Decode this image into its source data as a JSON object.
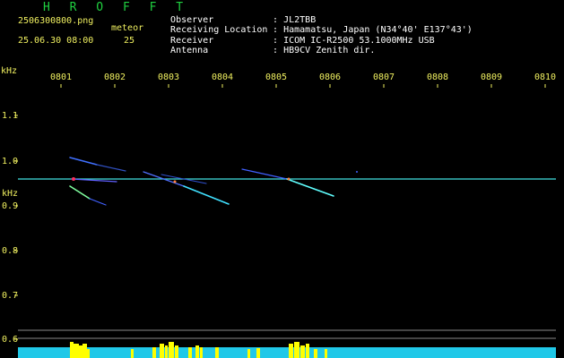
{
  "header": {
    "title": "H R O F F T",
    "filename": "2506300800.png",
    "datetime": "25.06.30 08:00",
    "meteor_label": "meteor",
    "meteor_count": "25"
  },
  "station_info": [
    {
      "label": "Observer",
      "value": ": JL2TBB"
    },
    {
      "label": "Receiving Location",
      "value": ": Hamamatsu, Japan (N34°40' E137°43')"
    },
    {
      "label": "Receiver",
      "value": ": ICOM IC-R2500 53.1000MHz USB"
    },
    {
      "label": "Antenna",
      "value": ": HB9CV Zenith dir."
    }
  ],
  "axes": {
    "freq_unit": "kHz",
    "time_labels": [
      "0801",
      "0802",
      "0803",
      "0804",
      "0805",
      "0806",
      "0807",
      "0808",
      "0809",
      "0810"
    ],
    "freq_labels": [
      "1.1",
      "1.0",
      "0.9",
      "0.8",
      "0.7",
      "0.6"
    ]
  },
  "colors": {
    "label": "#f0f060",
    "title": "#20d040",
    "carrier": "#40e0e0",
    "meteor_count_bars": "#ffff00",
    "noise_floor": "#20c8e8"
  }
}
